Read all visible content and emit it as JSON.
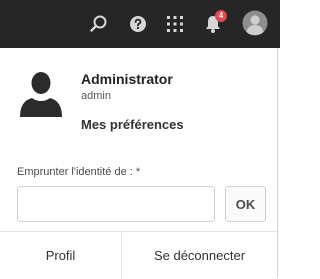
{
  "topbar": {
    "icons": {
      "search": "search-icon",
      "help": "help-icon",
      "solutions": "grid-icon",
      "notifications": "bell-icon",
      "user": "user-avatar-icon"
    },
    "notification_count": "4",
    "colors": {
      "background": "#262626",
      "icon": "#d7d7d7",
      "badge": "#e34850"
    }
  },
  "user_panel": {
    "name": "Administrator",
    "login": "admin",
    "preferences_link": "Mes préférences",
    "impersonate": {
      "label": "Emprunter l'identité de : *",
      "value": "",
      "ok_label": "OK"
    },
    "footer": {
      "profile_label": "Profil",
      "logout_label": "Se déconnecter"
    }
  }
}
